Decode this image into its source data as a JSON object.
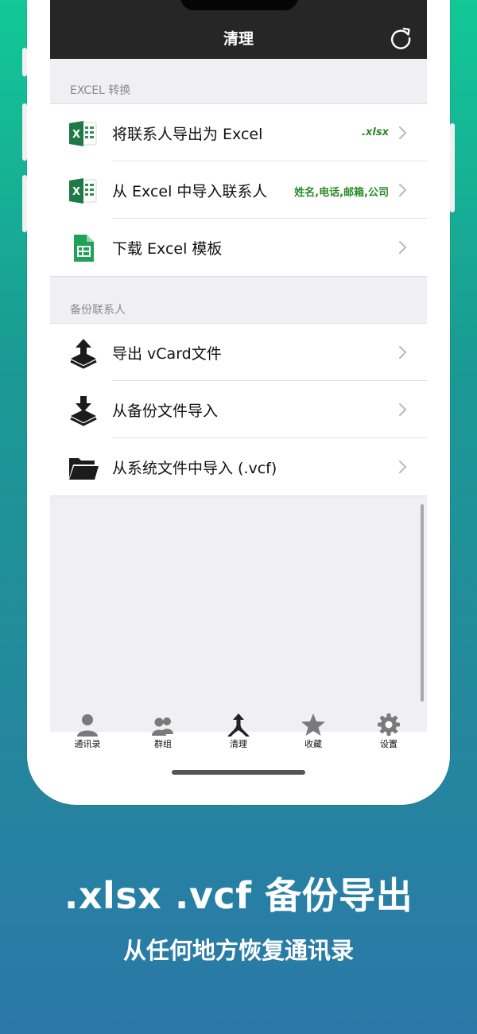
{
  "colors": {
    "navbar": "#262626",
    "accent_green": "#2a8a2a",
    "excel_green": "#1e7a45",
    "sheets_green": "#21a05a"
  },
  "nav": {
    "title": "清理",
    "refresh_icon": "refresh-icon"
  },
  "sections": [
    {
      "header": "EXCEL 转换",
      "rows": [
        {
          "label": "将联系人导出为 Excel",
          "tag": ".xlsx",
          "icon": "excel-icon"
        },
        {
          "label": "从 Excel 中导入联系人",
          "tag": "姓名,电话,邮箱,公司",
          "icon": "excel-icon"
        },
        {
          "label": "下载 Excel 模板",
          "tag": "",
          "icon": "spreadsheet-icon"
        }
      ]
    },
    {
      "header": "备份联系人",
      "rows": [
        {
          "label": "导出 vCard文件",
          "icon": "upload-tray-icon"
        },
        {
          "label": "从备份文件导入",
          "icon": "download-tray-icon"
        },
        {
          "label": "从系统文件中导入 (.vcf)",
          "icon": "folder-icon"
        }
      ]
    }
  ],
  "tabs": [
    {
      "label": "通讯录",
      "icon": "person-icon"
    },
    {
      "label": "群组",
      "icon": "group-icon"
    },
    {
      "label": "清理",
      "icon": "merge-arrow-icon",
      "active": true
    },
    {
      "label": "收藏",
      "icon": "star-icon"
    },
    {
      "label": "设置",
      "icon": "gear-icon"
    }
  ],
  "promo": {
    "headline": ".xlsx .vcf 备份导出",
    "subline": "从任何地方恢复通讯录"
  }
}
